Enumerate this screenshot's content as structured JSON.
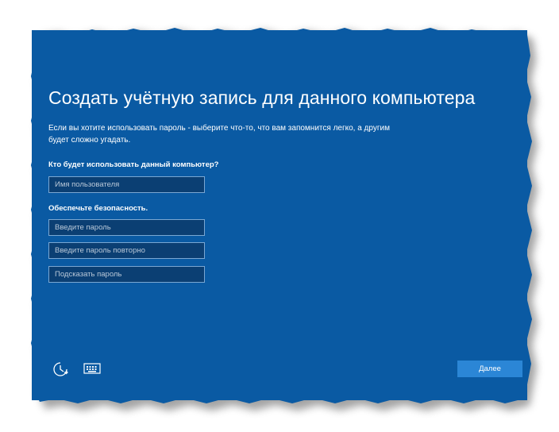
{
  "colors": {
    "panel_bg": "#0a5aa3",
    "field_bg": "#0b3f73",
    "field_border": "#7aa7d2",
    "button_bg": "#2b86d6",
    "text": "#ffffff"
  },
  "screen": {
    "title": "Создать учётную запись для данного компьютера",
    "description": "Если вы хотите использовать пароль - выберите что-то, что вам запомнится легко, а другим будет сложно угадать."
  },
  "user_section": {
    "label": "Кто будет использовать данный компьютер?",
    "username_placeholder": "Имя пользователя"
  },
  "security_section": {
    "label": "Обеспечьте безопасность.",
    "password_placeholder": "Введите пароль",
    "password_repeat_placeholder": "Введите пароль повторно",
    "hint_placeholder": "Подсказать пароль"
  },
  "footer": {
    "ease_of_access_icon": "ease-of-access-icon",
    "keyboard_icon": "keyboard-icon",
    "next_label": "Далее"
  }
}
